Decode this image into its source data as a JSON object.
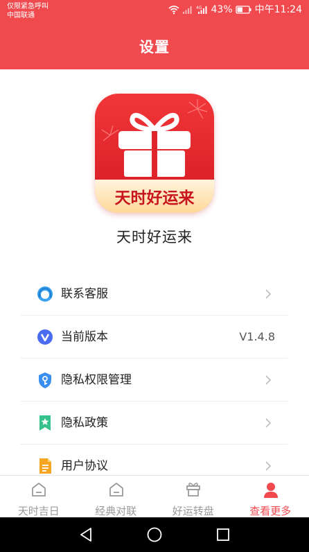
{
  "status_bar": {
    "line1": "仅限紧急呼叫",
    "line2": "中国联通",
    "battery": "43%",
    "time": "中午11:24"
  },
  "header": {
    "title": "设置"
  },
  "app": {
    "logo_text": "天时好运来",
    "name": "天时好运来"
  },
  "menu": {
    "items": [
      {
        "label": "联系客服",
        "icon": "customer-service-icon",
        "arrow": true
      },
      {
        "label": "当前版本",
        "icon": "version-icon",
        "value": "V1.4.8"
      },
      {
        "label": "隐私权限管理",
        "icon": "privacy-permission-icon",
        "arrow": true
      },
      {
        "label": "隐私政策",
        "icon": "privacy-policy-icon",
        "arrow": true
      },
      {
        "label": "用户协议",
        "icon": "user-agreement-icon",
        "arrow": true
      }
    ]
  },
  "tabs": [
    {
      "label": "天时吉日",
      "icon": "home-icon",
      "active": false
    },
    {
      "label": "经典对联",
      "icon": "home-icon",
      "active": false
    },
    {
      "label": "好运转盘",
      "icon": "gift-box-icon",
      "active": false
    },
    {
      "label": "查看更多",
      "icon": "user-icon",
      "active": true
    }
  ],
  "colors": {
    "brand_red": "#f04a4f",
    "tab_inactive": "#9a9a9a",
    "text_dark": "#222222"
  }
}
